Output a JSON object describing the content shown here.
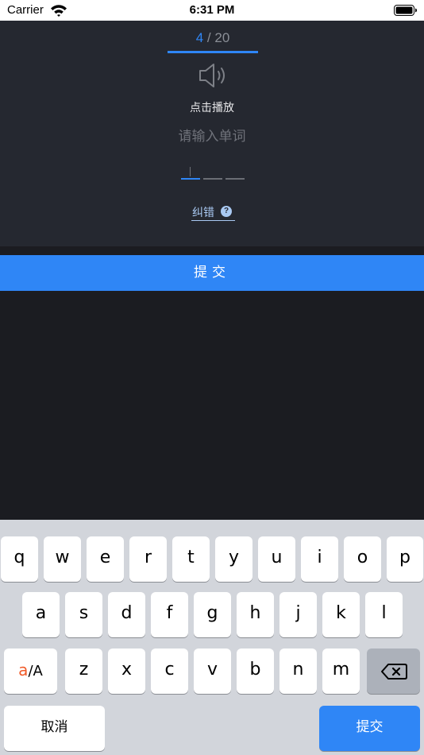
{
  "status_bar": {
    "carrier": "Carrier",
    "time": "6:31 PM"
  },
  "quiz": {
    "current": "4",
    "separator": " / ",
    "total": "20",
    "play_label": "点击播放",
    "input_placeholder": "请输入单词",
    "input_value": "",
    "letter_slots": 3,
    "correct_link": "纠错",
    "help_glyph": "?"
  },
  "submit_button": "提交",
  "keyboard": {
    "row1": [
      "q",
      "w",
      "e",
      "r",
      "t",
      "y",
      "u",
      "i",
      "o",
      "p"
    ],
    "row2": [
      "a",
      "s",
      "d",
      "f",
      "g",
      "h",
      "j",
      "k",
      "l"
    ],
    "row3": [
      "z",
      "x",
      "c",
      "v",
      "b",
      "n",
      "m"
    ],
    "lang_key_primary": "a",
    "lang_key_secondary": "/A",
    "cancel_key": "取消",
    "submit_key": "提交"
  },
  "colors": {
    "accent": "#2f86f6",
    "panel_bg": "#252830",
    "page_bg": "#1b1c21",
    "keyboard_bg": "#d2d5db"
  },
  "icons": [
    "wifi-icon",
    "battery-icon",
    "speaker-icon",
    "help-icon",
    "backspace-icon"
  ]
}
